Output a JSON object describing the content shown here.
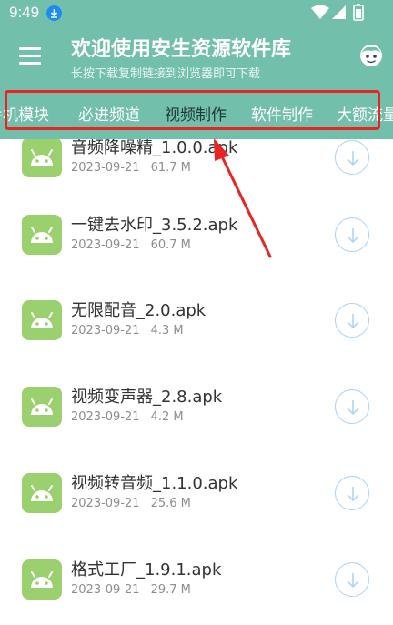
{
  "status": {
    "time": "9:49"
  },
  "header": {
    "title": "欢迎使用安生资源软件库",
    "subtitle": "长按下载复制链接到浏览器即可下载"
  },
  "tabs": [
    {
      "label": "手机模块",
      "active": false
    },
    {
      "label": "必进频道",
      "active": false
    },
    {
      "label": "视频制作",
      "active": true
    },
    {
      "label": "软件制作",
      "active": false
    },
    {
      "label": "大额流量",
      "active": false
    }
  ],
  "files": [
    {
      "name": "音频降噪精_1.0.0.apk",
      "date": "2023-09-21",
      "size": "61.7 M"
    },
    {
      "name": "一键去水印_3.5.2.apk",
      "date": "2023-09-21",
      "size": "60.7 M"
    },
    {
      "name": "无限配音_2.0.apk",
      "date": "2023-09-21",
      "size": "4.3 M"
    },
    {
      "name": "视频变声器_2.8.apk",
      "date": "2023-09-21",
      "size": "4.2 M"
    },
    {
      "name": "视频转音频_1.1.0.apk",
      "date": "2023-09-21",
      "size": "25.6 M"
    },
    {
      "name": "格式工厂_1.9.1.apk",
      "date": "2023-09-21",
      "size": "29.7 M"
    }
  ],
  "colors": {
    "header": "#72bfac",
    "annotation": "#e82424",
    "app_icon": "#9bd06f",
    "download_ring": "#a9d3f5"
  },
  "icons": {
    "menu": "menu-icon",
    "profile": "face-icon",
    "file": "android-icon",
    "download": "download-arrow-icon"
  }
}
